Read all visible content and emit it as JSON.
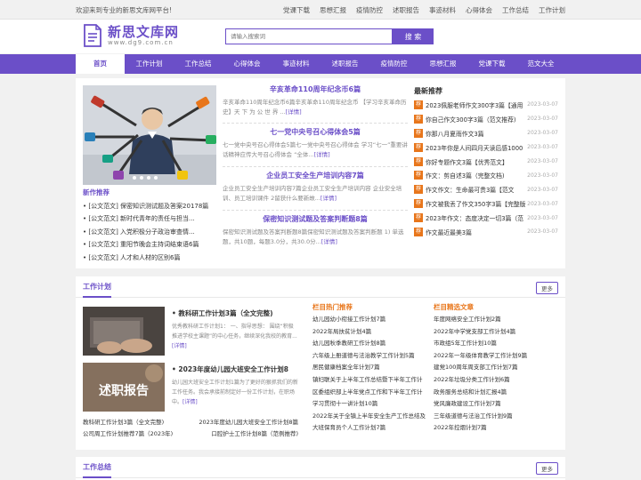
{
  "topbar": {
    "welcome": "欢迎来到专业的新思文库网平台!",
    "links": [
      "党课下载",
      "思想汇报",
      "疫情防控",
      "述职报告",
      "事迹材料",
      "心得体会",
      "工作总结",
      "工作计划"
    ]
  },
  "header": {
    "logo_title": "新思文库网",
    "logo_sub": "www.dg9.com.cn",
    "search_placeholder": "请输入搜索词",
    "search_button": "搜 索"
  },
  "nav": {
    "items": [
      "首页",
      "工作计划",
      "工作总结",
      "心得体会",
      "事迹材料",
      "述职报告",
      "疫情防控",
      "思想汇报",
      "党课下载",
      "范文大全"
    ],
    "active_index": 0
  },
  "colors": {
    "accent": "#6b4fc8",
    "orange": "#e8761b"
  },
  "news_rec": {
    "title": "新作推荐",
    "items": [
      "• [公文范文] 保密知识测试题及答案20178篇",
      "• [公文范文] 新时代青年的责任与担当...",
      "• [公文范文] 入党积极分子政治审查情...",
      "• [公文范文] 重阳节晚会主持词结束语6篇",
      "• [公文范文] 人才和人材的区别6篇"
    ]
  },
  "features": [
    {
      "title": "辛亥革命110周年纪念币6篇",
      "desc": "辛亥革命110周年纪念币6篇辛亥革命110周年纪念币 【学习辛亥革命历史】天 下 为 公 世 界 ...",
      "more": "[详情]"
    },
    {
      "title": "七一党中央号召心得体会5篇",
      "desc": "七一党中央号召心得体会5篇七一党中央号召心得体会 学习“七一”重要讲话精神应传大号召心得体会 “全体...",
      "more": "[详情]"
    },
    {
      "title": "企业员工安全生产培训内容7篇",
      "desc": "企业员工安全生产培训内容7篇企业员工安全生产培训内容 企业安全培训、员工培训课件 2留获什么要新故...",
      "more": "[详情]"
    },
    {
      "title": "保密知识测试题及答案判断题8篇",
      "desc": "保密知识测试题及答案判断题8篇保密知识测试题及答案判断题 1) 单选题，共10题，每题3.0分，共30.0分...",
      "more": "[详情]"
    }
  ],
  "latest": {
    "title": "最新推荐",
    "items": [
      {
        "badge": "荐",
        "text": "2023佩服老师作文300字3篇【通用",
        "date": "2023-03-07"
      },
      {
        "badge": "荐",
        "text": "你自己作文300字3篇（范文推荐)",
        "date": "2023-03-07"
      },
      {
        "badge": "荐",
        "text": "你那八月夏雨作文3篇",
        "date": "2023-03-07"
      },
      {
        "badge": "荐",
        "text": "2023年你是人间四月天读后感1000",
        "date": "2023-03-07"
      },
      {
        "badge": "荐",
        "text": "你好专题作文3篇【优秀范文】",
        "date": "2023-03-07"
      },
      {
        "badge": "荐",
        "text": "作文：剪自述3篇（完整文档)",
        "date": "2023-03-07"
      },
      {
        "badge": "荐",
        "text": "作文作文：生命最可贵3篇【范文",
        "date": "2023-03-07"
      },
      {
        "badge": "荐",
        "text": "作文被我丢了作文350字3篇【完整版",
        "date": "2023-03-07"
      },
      {
        "badge": "荐",
        "text": "2023年作文：态度决定一切3篇（范",
        "date": "2023-03-07"
      },
      {
        "badge": "荐",
        "text": "作文最近最美3篇",
        "date": "2023-03-07"
      }
    ]
  },
  "plan_section": {
    "title": "工作计划",
    "more": "更多",
    "items": [
      {
        "title": "•  教科研工作计划3篇（全文完整)",
        "desc": "优秀教科研工作计划1： 一、指导思想： 围绕“积极推进学校主课题”的中心任务，继续深化我校的教育...",
        "more": "[详情]",
        "img_text": ""
      },
      {
        "title": "•  2023年度幼儿园大班安全工作计划8",
        "desc": "幼儿园大班安全工作计划1篇为了更好的狠抓我们的新工作任务。我会承接前制定好一份工作计划，在职场中。",
        "more": "[详情]",
        "img_text": "述职报告"
      }
    ],
    "links": [
      [
        "教科研工作计划3篇（全文完整)",
        "2023年度幼儿园大班安全工作计划8篇"
      ],
      [
        "公司周工作计划推荐7篇（2023年)",
        "口腔护士工作计划8篇（范例推荐)"
      ]
    ],
    "col1": {
      "title": "栏目热门推荐",
      "items": [
        "幼儿园幼小衔接工作计划7篇",
        "2022年局扶贫计划4篇",
        "幼儿园秋季教研工作计划8篇",
        "六年级上册道德与法治教学工作计划5篇",
        "居民健康档案全年计划7篇",
        "镇妇联关于上半年工作总结暨下半年工作计",
        "区委组织部上半年党点工作和下半年工作计",
        "学习贯彻十一讲计划10篇",
        "2022年关于全镇上半年安全生产工作总结及",
        "大班保育员个人工作计划7篇"
      ]
    },
    "col2": {
      "title": "栏目精选文章",
      "items": [
        "年度网络安全工作计划2篇",
        "2022年中学党支部工作计划4篇",
        "市政组5年工作计划10篇",
        "2022年一年级体育教学工作计划9篇",
        "建党100周年周支部工作计划7篇",
        "2022年垃圾分类工作计划6篇",
        "政务服务总结和计划汇报4篇",
        "党风廉政建设工作计划7篇",
        "三年级道德与法治工作计划9篇",
        "2022年控烟计划7篇"
      ]
    }
  },
  "summary_section": {
    "title": "工作总结",
    "more": "更多"
  }
}
